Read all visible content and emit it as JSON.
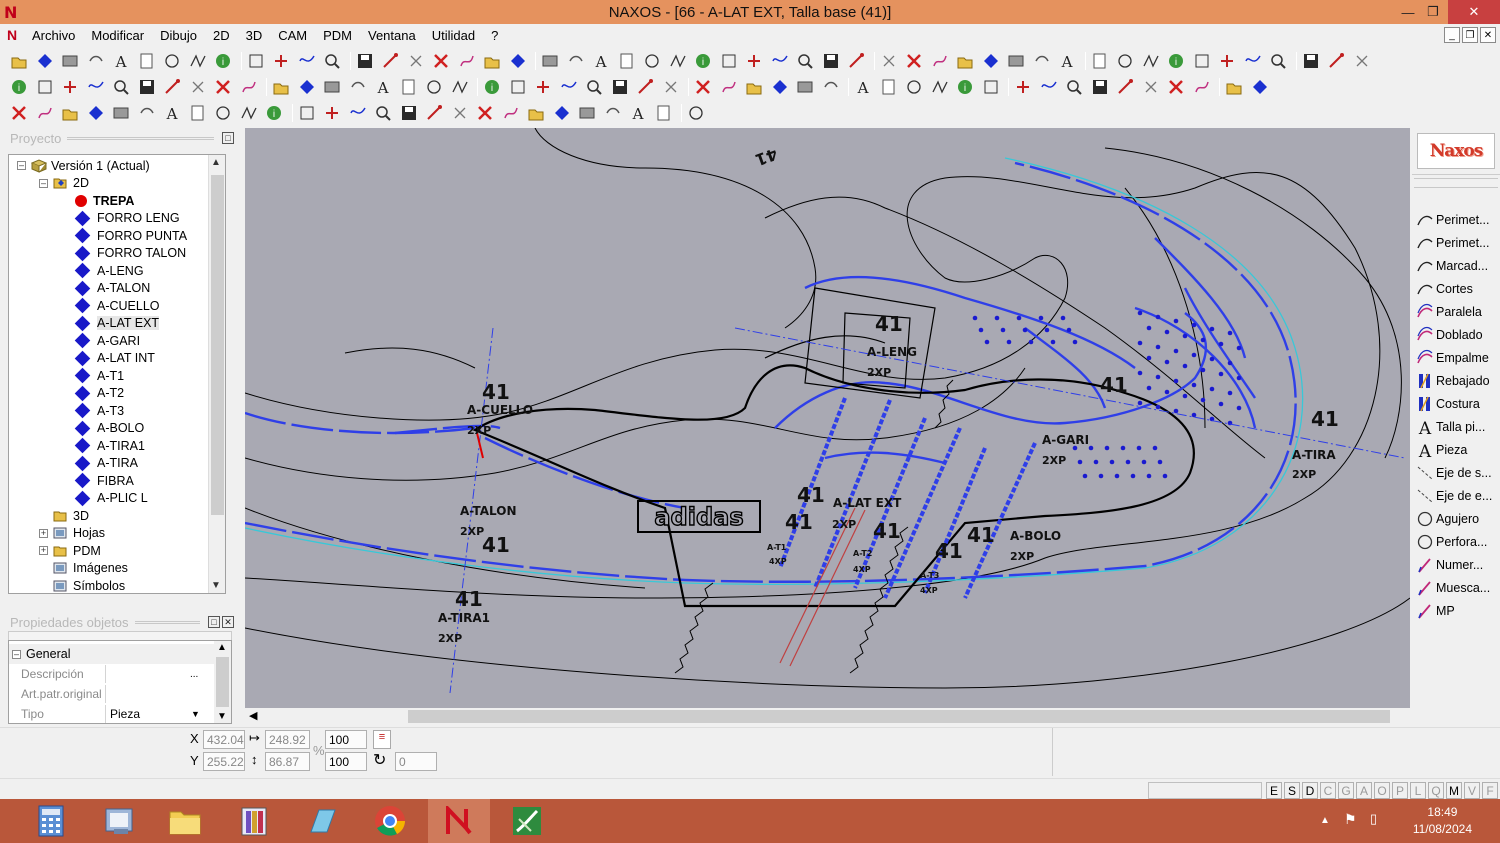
{
  "window": {
    "title": "NAXOS - [66 - A-LAT EXT, Talla base (41)]"
  },
  "menu": [
    "Archivo",
    "Modificar",
    "Dibujo",
    "2D",
    "3D",
    "CAM",
    "PDM",
    "Ventana",
    "Utilidad",
    "?"
  ],
  "project_panel": {
    "header": "Proyecto",
    "tree": [
      {
        "label": "Versión 1 (Actual)",
        "level": 0,
        "icon": "version",
        "expander": "-"
      },
      {
        "label": "2D",
        "level": 1,
        "icon": "folder-2d",
        "expander": "-"
      },
      {
        "label": "TREPA",
        "level": 2,
        "icon": "red-dot",
        "bold": true
      },
      {
        "label": "FORRO LENG",
        "level": 2,
        "icon": "piece"
      },
      {
        "label": "FORRO PUNTA",
        "level": 2,
        "icon": "piece"
      },
      {
        "label": "FORRO TALON",
        "level": 2,
        "icon": "piece"
      },
      {
        "label": "A-LENG",
        "level": 2,
        "icon": "piece"
      },
      {
        "label": "A-TALON",
        "level": 2,
        "icon": "piece"
      },
      {
        "label": "A-CUELLO",
        "level": 2,
        "icon": "piece"
      },
      {
        "label": "A-LAT EXT",
        "level": 2,
        "icon": "piece",
        "selected": true
      },
      {
        "label": "A-GARI",
        "level": 2,
        "icon": "piece"
      },
      {
        "label": "A-LAT INT",
        "level": 2,
        "icon": "piece"
      },
      {
        "label": "A-T1",
        "level": 2,
        "icon": "piece"
      },
      {
        "label": "A-T2",
        "level": 2,
        "icon": "piece"
      },
      {
        "label": "A-T3",
        "level": 2,
        "icon": "piece"
      },
      {
        "label": "A-BOLO",
        "level": 2,
        "icon": "piece"
      },
      {
        "label": "A-TIRA1",
        "level": 2,
        "icon": "piece"
      },
      {
        "label": "A-TIRA",
        "level": 2,
        "icon": "piece"
      },
      {
        "label": "FIBRA",
        "level": 2,
        "icon": "piece"
      },
      {
        "label": "A-PLIC L",
        "level": 2,
        "icon": "piece"
      },
      {
        "label": "3D",
        "level": 1,
        "icon": "folder-3d"
      },
      {
        "label": "Hojas",
        "level": 1,
        "icon": "sheets",
        "expander": "+"
      },
      {
        "label": "PDM",
        "level": 1,
        "icon": "folder",
        "expander": "+"
      },
      {
        "label": "Imágenes",
        "level": 1,
        "icon": "images"
      },
      {
        "label": "Símbolos",
        "level": 1,
        "icon": "symbols"
      }
    ]
  },
  "properties_panel": {
    "header": "Propiedades objetos",
    "group": "General",
    "rows": [
      {
        "label": "Descripción",
        "value": "",
        "button": "..."
      },
      {
        "label": "Art.patr.original",
        "value": ""
      },
      {
        "label": "Tipo",
        "value": "Pieza",
        "dropdown": true
      }
    ]
  },
  "drawing": {
    "labels": [
      {
        "t": "41",
        "big": true
      },
      {
        "t": "A-CUELLO"
      },
      {
        "t": "2XP"
      },
      {
        "t": "A-TALON"
      },
      {
        "t": "2XP"
      },
      {
        "t": "41",
        "big": true
      },
      {
        "t": "41",
        "big": true
      },
      {
        "t": "A-TIRA1"
      },
      {
        "t": "2XP"
      },
      {
        "t": "41",
        "big": true
      },
      {
        "t": "A-LENG"
      },
      {
        "t": "2XP"
      },
      {
        "t": "41",
        "big": true
      },
      {
        "t": "A-GARI"
      },
      {
        "t": "2XP"
      },
      {
        "t": "41",
        "big": true
      },
      {
        "t": "A-TIRA"
      },
      {
        "t": "2XP"
      },
      {
        "t": "41",
        "big": true
      },
      {
        "t": "A-LAT EXT"
      },
      {
        "t": "41",
        "big": true
      },
      {
        "t": "2XP"
      },
      {
        "t": "41",
        "big": true
      },
      {
        "t": "41",
        "big": true
      },
      {
        "t": "41",
        "big": true
      },
      {
        "t": "A-BOLO"
      },
      {
        "t": "2XP"
      },
      {
        "t": "A-T1"
      },
      {
        "t": "4XP"
      },
      {
        "t": "A-T2"
      },
      {
        "t": "4XP"
      },
      {
        "t": "A-T3"
      },
      {
        "t": "4XP"
      },
      {
        "t": "41"
      }
    ],
    "logo_text": "adidas"
  },
  "tools_palette": {
    "logo": "Naxos",
    "items": [
      {
        "label": "Perimet...",
        "icon": "curve"
      },
      {
        "label": "Perimet...",
        "icon": "curve"
      },
      {
        "label": "Marcad...",
        "icon": "curve"
      },
      {
        "label": "Cortes",
        "icon": "curve"
      },
      {
        "label": "Paralela",
        "icon": "curve-pink"
      },
      {
        "label": "Doblado",
        "icon": "curve-pink"
      },
      {
        "label": "Empalme",
        "icon": "curve-pink"
      },
      {
        "label": "Rebajado",
        "icon": "stitch"
      },
      {
        "label": "Costura",
        "icon": "stitch"
      },
      {
        "label": "Talla pi...",
        "icon": "letter-a"
      },
      {
        "label": "Pieza",
        "icon": "letter-a"
      },
      {
        "label": "Eje de s...",
        "icon": "axis"
      },
      {
        "label": "Eje de e...",
        "icon": "axis"
      },
      {
        "label": "Agujero",
        "icon": "circle"
      },
      {
        "label": "Perfora...",
        "icon": "circle"
      },
      {
        "label": "Numer...",
        "icon": "pen"
      },
      {
        "label": "Muesca...",
        "icon": "pen"
      },
      {
        "label": "MP",
        "icon": "pen"
      }
    ]
  },
  "coords": {
    "x_label": "X",
    "x": "432.04",
    "y_label": "Y",
    "y": "255.22",
    "width": "248.92",
    "height": "86.87",
    "scale_x": "100",
    "scale_y": "100",
    "percent": "%",
    "angle": "0"
  },
  "status_flags": [
    {
      "t": "E",
      "on": true
    },
    {
      "t": "S",
      "on": true
    },
    {
      "t": "D",
      "on": true
    },
    {
      "t": "C",
      "on": false
    },
    {
      "t": "G",
      "on": false
    },
    {
      "t": "A",
      "on": false
    },
    {
      "t": "O",
      "on": false
    },
    {
      "t": "P",
      "on": false
    },
    {
      "t": "L",
      "on": false
    },
    {
      "t": "Q",
      "on": false
    },
    {
      "t": "M",
      "on": true
    },
    {
      "t": "V",
      "on": false
    },
    {
      "t": "F",
      "on": false
    }
  ],
  "taskbar": {
    "time": "18:49",
    "date": "11/08/2024"
  },
  "colors": {
    "titlebar": "#e5925e",
    "taskbar": "#b9573a",
    "canvas": "#a9a9b3",
    "piece_blue": "#1a1ad0",
    "curve_blue": "#2f3fe8",
    "cyan_line": "#38c8d8"
  }
}
